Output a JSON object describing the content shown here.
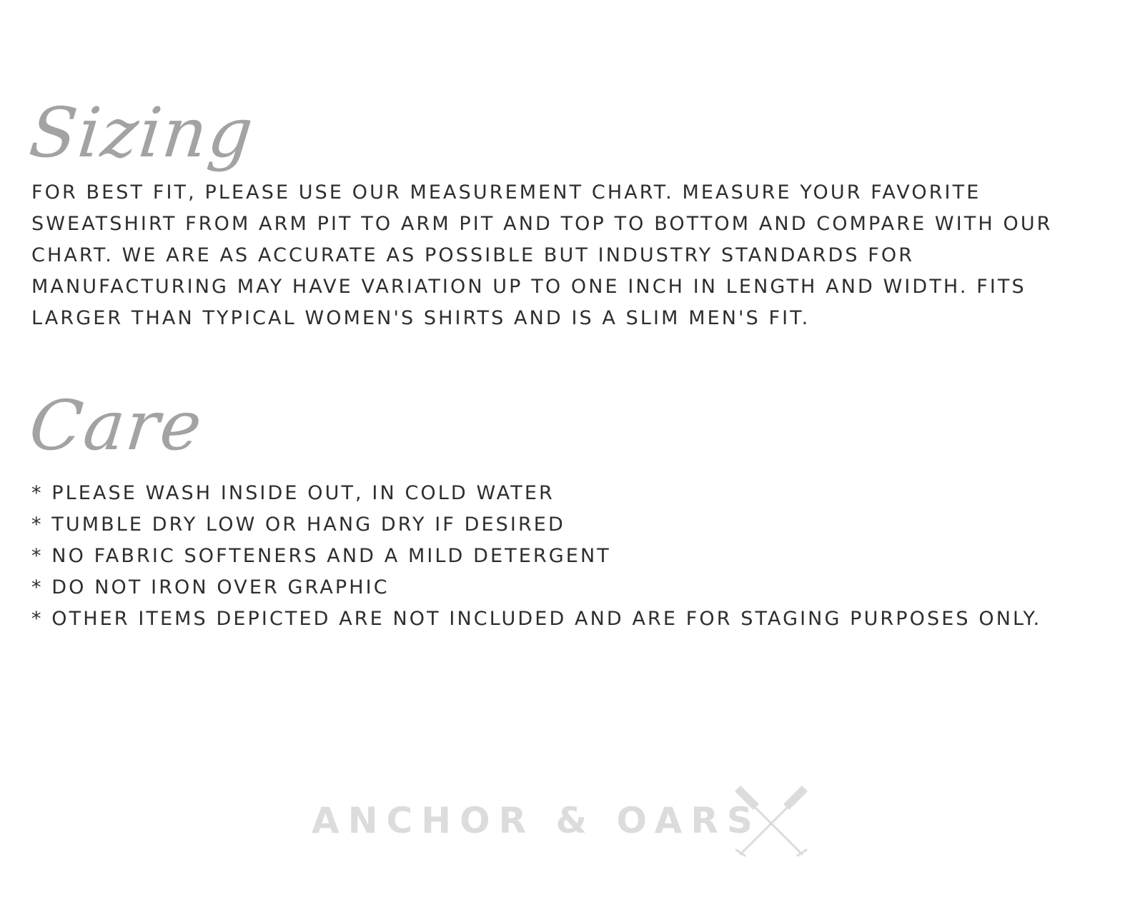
{
  "sizing": {
    "heading": "Sizing",
    "paragraph": "FOR BEST FIT, PLEASE USE OUR MEASUREMENT CHART. MEASURE YOUR FAVORITE SWEATSHIRT FROM ARM PIT TO ARM PIT AND TOP TO BOTTOM AND COMPARE WITH OUR CHART. WE ARE AS ACCURATE AS POSSIBLE BUT INDUSTRY STANDARDS FOR MANUFACTURING MAY HAVE VARIATION UP TO ONE INCH IN LENGTH AND WIDTH. FITS LARGER THAN TYPICAL WOMEN'S SHIRTS AND IS A SLIM MEN'S FIT."
  },
  "care": {
    "heading": "Care",
    "items": [
      "* PLEASE WASH INSIDE OUT, IN COLD WATER",
      "* TUMBLE DRY LOW OR HANG DRY IF DESIRED",
      "* NO FABRIC SOFTENERS AND A MILD DETERGENT",
      "* DO NOT IRON OVER GRAPHIC",
      "* OTHER ITEMS DEPICTED ARE NOT INCLUDED AND ARE FOR STAGING PURPOSES ONLY."
    ]
  },
  "brand": {
    "name": "ANCHOR & OARS",
    "icon": "crossed-oars-icon"
  },
  "colors": {
    "heading": "#a3a3a3",
    "text": "#2e2e2e",
    "brand": "#dcdcdc"
  }
}
